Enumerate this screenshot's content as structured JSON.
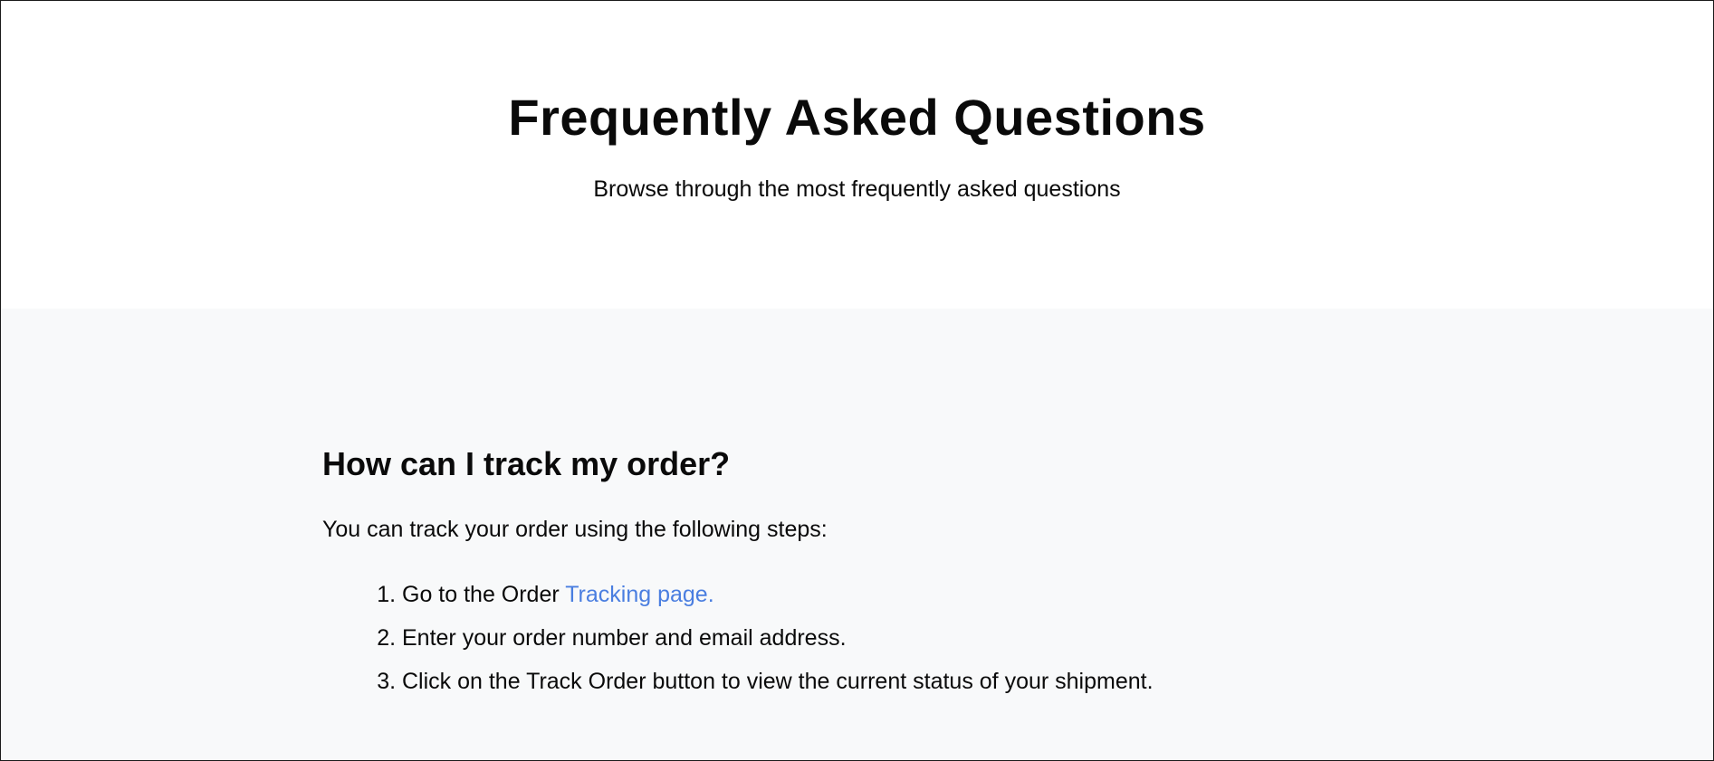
{
  "hero": {
    "title": "Frequently Asked Questions",
    "subtitle": "Browse through the most frequently asked questions"
  },
  "faq": {
    "question": "How can I track my order?",
    "intro": "You can track your order using the following steps:",
    "steps": [
      {
        "text": "Go to the Order ",
        "link": "Tracking page."
      },
      {
        "text": "Enter your order number and email address."
      },
      {
        "text": "Click on the Track Order button to view the current status of your shipment."
      }
    ]
  },
  "colors": {
    "hero_bg": "#ffffff",
    "faq_bg": "#f8f9fa",
    "link": "#4a7ee0",
    "text": "#0a0a0a"
  }
}
